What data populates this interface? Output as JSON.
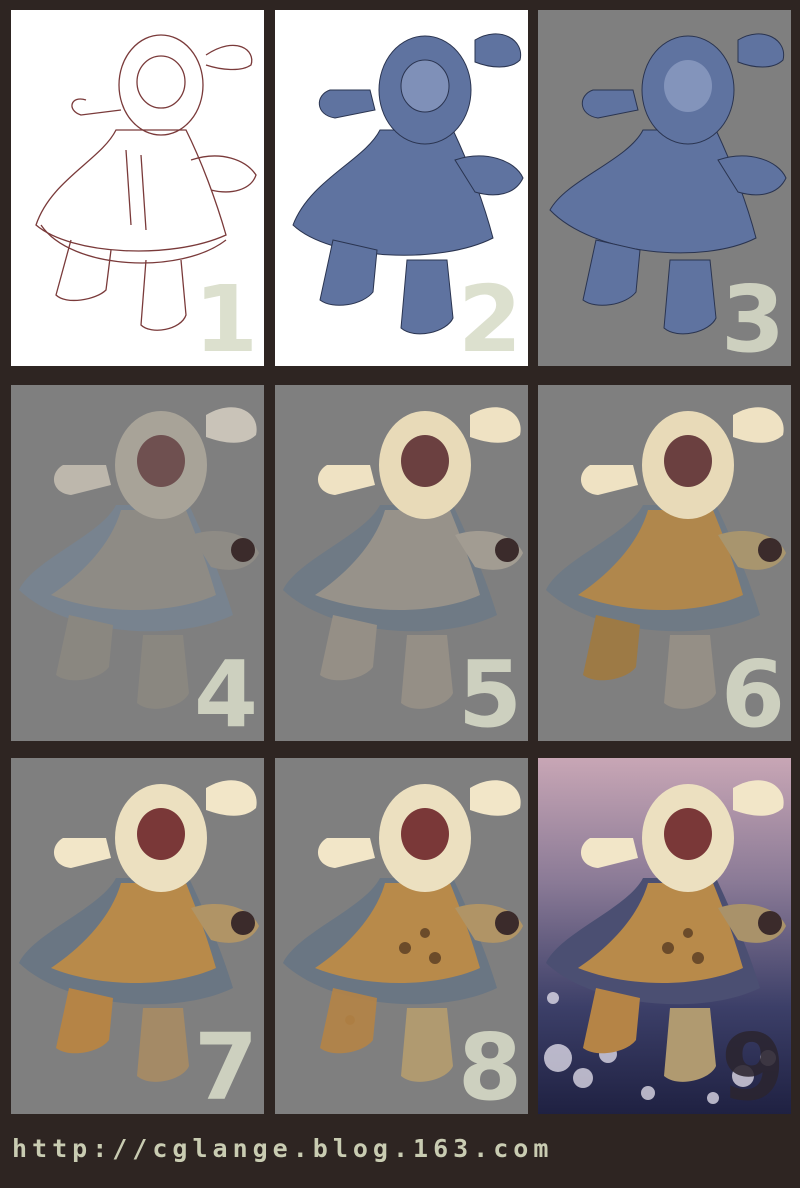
{
  "panels": [
    {
      "number": "1",
      "stage": "sketch"
    },
    {
      "number": "2",
      "stage": "flat-fill-white"
    },
    {
      "number": "3",
      "stage": "flat-fill-grey"
    },
    {
      "number": "4",
      "stage": "base-shading"
    },
    {
      "number": "5",
      "stage": "cream-fur"
    },
    {
      "number": "6",
      "stage": "ochre-coat"
    },
    {
      "number": "7",
      "stage": "warm-refine"
    },
    {
      "number": "8",
      "stage": "spotted-pattern"
    },
    {
      "number": "9",
      "stage": "snow-background"
    }
  ],
  "footer": {
    "url": "http://cglange.blog.163.com"
  },
  "colors": {
    "border": "#2e2522",
    "panel_white": "#ffffff",
    "panel_grey": "#7f7f7f",
    "number": "#d8dcc8",
    "url": "#c9ccb2",
    "blue": "#5f73a0",
    "cream": "#efe2c3",
    "ochre": "#b88a4a"
  }
}
